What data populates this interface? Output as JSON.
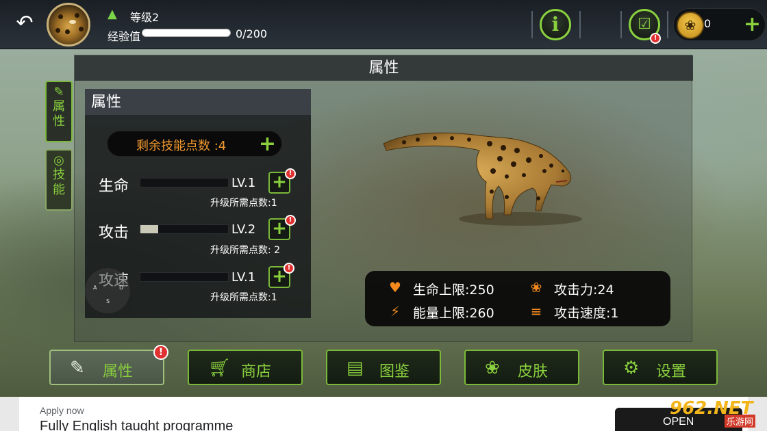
{
  "topbar": {
    "back_icon": "back-arrow-icon",
    "level_label": "等级2",
    "exp_label": "经验值",
    "exp_value": "0/200",
    "exp_progress": 0,
    "currency_value": "0",
    "alert_mark": "!"
  },
  "panel": {
    "title": "属性"
  },
  "side_tabs": [
    {
      "label": "属性",
      "icon": "document-edit-icon"
    },
    {
      "label": "技能",
      "icon": "swirl-icon"
    }
  ],
  "attributes": {
    "title": "属性",
    "skill_points_text": "剩余技能点数 :4",
    "stats": [
      {
        "name": "生命",
        "level": "LV.1",
        "requirement": "升级所需点数:1",
        "progress": 0
      },
      {
        "name": "攻击",
        "level": "LV.2",
        "requirement": "升级所需点数: 2",
        "progress": 0.2
      },
      {
        "name": "攻速",
        "level": "LV.1",
        "requirement": "升级所需点数:1",
        "progress": 0
      }
    ],
    "joystick_labels": {
      "left": "A",
      "right": "D",
      "bottom": "S"
    }
  },
  "summary": {
    "hp_max": "生命上限:250",
    "energy_max": "能量上限:260",
    "attack": "攻击力:24",
    "attack_speed": "攻击速度:1"
  },
  "bottom_nav": [
    {
      "label": "属性",
      "icon": "document-edit-icon",
      "active": true
    },
    {
      "label": "商店",
      "icon": "cart-icon",
      "active": false
    },
    {
      "label": "图鉴",
      "icon": "book-icon",
      "active": false
    },
    {
      "label": "皮肤",
      "icon": "palette-icon",
      "active": false
    },
    {
      "label": "设置",
      "icon": "gear-icon",
      "active": false
    }
  ],
  "ad": {
    "apply_text": "Apply now",
    "headline": "Fully English taught programme",
    "cta": "OPEN"
  },
  "watermark": {
    "main": "962.NET",
    "sub": "乐游网"
  },
  "colors": {
    "accent_green": "#8ad13e",
    "skill_points_orange": "#f29a2e",
    "alert_red": "#e03030",
    "stat_icon_orange": "#f48a1e"
  }
}
